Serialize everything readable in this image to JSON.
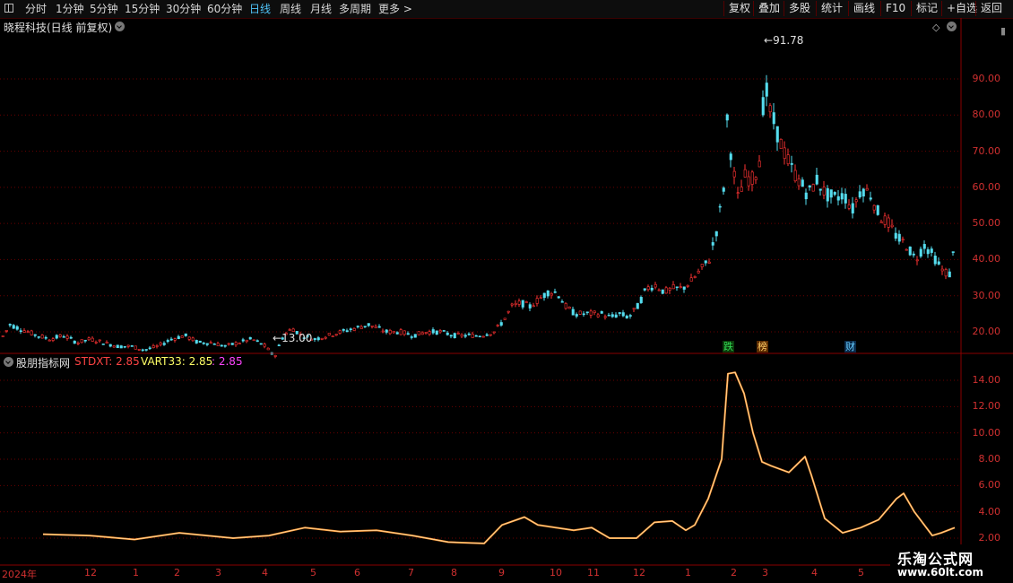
{
  "toolbar": {
    "left_items": [
      "分时",
      "1分钟",
      "5分钟",
      "15分钟",
      "30分钟",
      "60分钟",
      "日线",
      "周线",
      "月线",
      "多周期",
      "更多 >"
    ],
    "active_item": "日线",
    "right_items": [
      "复权",
      "叠加",
      "多股",
      "统计",
      "画线",
      "F10",
      "标记",
      "+自选",
      "返回"
    ]
  },
  "main_panel": {
    "title": "晓程科技(日线 前复权)",
    "y_ticks": [
      "90.00",
      "80.00",
      "70.00",
      "60.00",
      "50.00",
      "40.00",
      "30.00",
      "20.00"
    ],
    "high_label": "91.78",
    "low_label": "13.00",
    "tags": [
      {
        "text": "跌",
        "color": "#33dd55",
        "bg": "#0a3a0a"
      },
      {
        "text": "榜",
        "color": "#ffcc66",
        "bg": "#5a2a00"
      },
      {
        "text": "财",
        "color": "#66ccff",
        "bg": "#0a2a4a"
      }
    ]
  },
  "indicator_panel": {
    "name": "股朋指标网",
    "stdxt_label": "STDXT: 2.85",
    "vart33_label": "VART33: 2.85",
    "extra_label": ": 2.85",
    "y_ticks": [
      "14.00",
      "12.00",
      "10.00",
      "8.00",
      "6.00",
      "4.00",
      "2.00"
    ]
  },
  "x_axis": {
    "labels": [
      "2024年",
      "12",
      "1",
      "2",
      "3",
      "4",
      "5",
      "6",
      "7",
      "8",
      "9",
      "10",
      "11",
      "12",
      "1",
      "2",
      "3",
      "4",
      "5"
    ]
  },
  "watermark": {
    "line1": "乐淘公式网",
    "line2": "www.60lt.com"
  },
  "colors": {
    "up": "#ff3333",
    "down": "#55ddee",
    "grid": "#6a0000",
    "indicator": "#ff9933",
    "stdxt": "#ff4444",
    "vart33": "#ffff66",
    "extra": "#ff44ff"
  },
  "chart_data": {
    "type": "candlestick",
    "price_ylim": [
      10,
      95
    ],
    "indicator_ylim": [
      2,
      15
    ],
    "price_path": [
      [
        0,
        18
      ],
      [
        10,
        22
      ],
      [
        20,
        21
      ],
      [
        30,
        20
      ],
      [
        40,
        19
      ],
      [
        55,
        18
      ],
      [
        70,
        19
      ],
      [
        85,
        17
      ],
      [
        100,
        18
      ],
      [
        115,
        17
      ],
      [
        130,
        16
      ],
      [
        145,
        16
      ],
      [
        160,
        15
      ],
      [
        175,
        16
      ],
      [
        190,
        18
      ],
      [
        205,
        19
      ],
      [
        220,
        17
      ],
      [
        235,
        17
      ],
      [
        250,
        16
      ],
      [
        265,
        17
      ],
      [
        280,
        18
      ],
      [
        295,
        16
      ],
      [
        305,
        13
      ],
      [
        315,
        19
      ],
      [
        325,
        21
      ],
      [
        335,
        19
      ],
      [
        350,
        18
      ],
      [
        365,
        19
      ],
      [
        380,
        20
      ],
      [
        395,
        21
      ],
      [
        410,
        22
      ],
      [
        420,
        21
      ],
      [
        430,
        20
      ],
      [
        445,
        20
      ],
      [
        460,
        19
      ],
      [
        475,
        20
      ],
      [
        490,
        20
      ],
      [
        505,
        19
      ],
      [
        520,
        19
      ],
      [
        535,
        19
      ],
      [
        550,
        20
      ],
      [
        560,
        23
      ],
      [
        570,
        27
      ],
      [
        580,
        28
      ],
      [
        590,
        27
      ],
      [
        600,
        29
      ],
      [
        610,
        31
      ],
      [
        620,
        31
      ],
      [
        630,
        27
      ],
      [
        640,
        25
      ],
      [
        650,
        25
      ],
      [
        660,
        25
      ],
      [
        670,
        25
      ],
      [
        680,
        24
      ],
      [
        690,
        25
      ],
      [
        700,
        24
      ],
      [
        710,
        27
      ],
      [
        720,
        32
      ],
      [
        730,
        33
      ],
      [
        740,
        31
      ],
      [
        750,
        32
      ],
      [
        760,
        32
      ],
      [
        770,
        34
      ],
      [
        780,
        37
      ],
      [
        790,
        40
      ],
      [
        800,
        50
      ],
      [
        806,
        60
      ],
      [
        810,
        78
      ],
      [
        816,
        66
      ],
      [
        822,
        57
      ],
      [
        830,
        63
      ],
      [
        840,
        62
      ],
      [
        846,
        68
      ],
      [
        852,
        90
      ],
      [
        856,
        82
      ],
      [
        862,
        78
      ],
      [
        870,
        72
      ],
      [
        880,
        66
      ],
      [
        890,
        62
      ],
      [
        900,
        58
      ],
      [
        910,
        62
      ],
      [
        920,
        58
      ],
      [
        930,
        57
      ],
      [
        940,
        58
      ],
      [
        950,
        54
      ],
      [
        960,
        60
      ],
      [
        970,
        58
      ],
      [
        980,
        52
      ],
      [
        990,
        50
      ],
      [
        1000,
        46
      ],
      [
        1010,
        44
      ],
      [
        1020,
        40
      ],
      [
        1030,
        44
      ],
      [
        1040,
        41
      ],
      [
        1050,
        37
      ],
      [
        1058,
        36
      ],
      [
        1064,
        44
      ]
    ],
    "indicator_path": [
      [
        48,
        2.3
      ],
      [
        100,
        2.2
      ],
      [
        150,
        1.9
      ],
      [
        200,
        2.4
      ],
      [
        260,
        2.0
      ],
      [
        300,
        2.2
      ],
      [
        340,
        2.8
      ],
      [
        380,
        2.5
      ],
      [
        420,
        2.6
      ],
      [
        460,
        2.2
      ],
      [
        500,
        1.7
      ],
      [
        540,
        1.6
      ],
      [
        560,
        3.0
      ],
      [
        585,
        3.6
      ],
      [
        600,
        3.0
      ],
      [
        620,
        2.8
      ],
      [
        640,
        2.6
      ],
      [
        660,
        2.8
      ],
      [
        680,
        2.0
      ],
      [
        710,
        2.0
      ],
      [
        730,
        3.2
      ],
      [
        750,
        3.3
      ],
      [
        765,
        2.6
      ],
      [
        775,
        3.0
      ],
      [
        790,
        5.0
      ],
      [
        805,
        8.0
      ],
      [
        812,
        14.5
      ],
      [
        820,
        14.6
      ],
      [
        830,
        13.0
      ],
      [
        840,
        10.0
      ],
      [
        850,
        7.8
      ],
      [
        860,
        7.5
      ],
      [
        880,
        7.0
      ],
      [
        898,
        8.2
      ],
      [
        905,
        6.8
      ],
      [
        920,
        3.5
      ],
      [
        940,
        2.4
      ],
      [
        960,
        2.8
      ],
      [
        980,
        3.4
      ],
      [
        1000,
        5.0
      ],
      [
        1008,
        5.4
      ],
      [
        1020,
        4.0
      ],
      [
        1040,
        2.2
      ],
      [
        1050,
        2.4
      ],
      [
        1065,
        2.8
      ]
    ]
  }
}
